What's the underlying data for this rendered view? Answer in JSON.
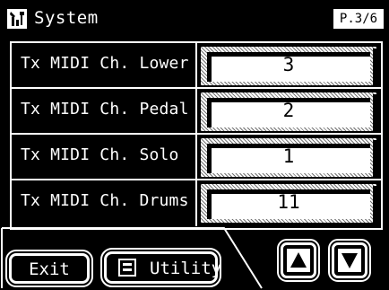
{
  "title": {
    "text": "System",
    "icon": "system-tools-icon"
  },
  "page_badge": "P.3/6",
  "rows": [
    {
      "label": "Tx MIDI Ch. Lower",
      "value": "3"
    },
    {
      "label": "Tx MIDI Ch. Pedal",
      "value": "2"
    },
    {
      "label": "Tx MIDI Ch. Solo",
      "value": "1"
    },
    {
      "label": "Tx MIDI Ch. Drums",
      "value": "11"
    }
  ],
  "buttons": {
    "exit": "Exit",
    "utility": "Utility",
    "up_icon": "arrow-up-icon",
    "down_icon": "arrow-down-icon"
  },
  "colors": {
    "background": "#000000",
    "foreground": "#ffffff"
  }
}
